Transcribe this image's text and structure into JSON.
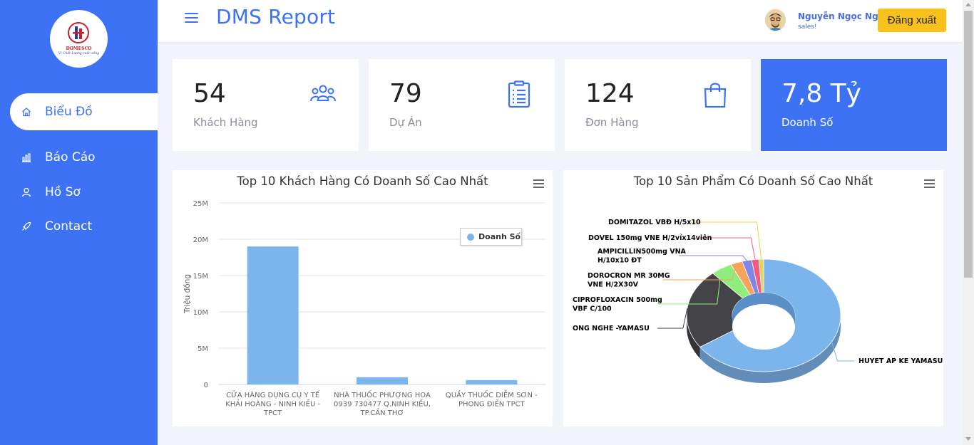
{
  "app": {
    "title": "DMS Report",
    "logo": {
      "brand": "DOMESCO",
      "slogan": "Vì Chất Lượng cuộc sống"
    }
  },
  "sidebar": {
    "items": [
      {
        "label": "Biểu Đồ",
        "icon": "home-icon",
        "active": true
      },
      {
        "label": "Báo Cáo",
        "icon": "bar-chart-icon",
        "active": false
      },
      {
        "label": "Hồ Sơ",
        "icon": "user-icon",
        "active": false
      },
      {
        "label": "Contact",
        "icon": "rocket-icon",
        "active": false
      }
    ]
  },
  "header": {
    "user_name": "Nguyễn Ngọc Ngân",
    "user_role": "sales!",
    "logout_label": "Đăng xuất"
  },
  "stats": [
    {
      "value": "54",
      "label": "Khách Hàng",
      "icon": "users-icon"
    },
    {
      "value": "79",
      "label": "Dự Án",
      "icon": "clipboard-icon"
    },
    {
      "value": "124",
      "label": "Đơn Hàng",
      "icon": "shopping-bag-icon"
    },
    {
      "value": "7,8 Tỷ",
      "label": "Doanh Số"
    }
  ],
  "colors": {
    "primary": "#3d72f5",
    "logout": "#f9c11b",
    "bar": "#7cb5ec"
  },
  "chart_data": [
    {
      "type": "bar",
      "title": "Top 10 Khách Hàng Có Doanh Số Cao Nhất",
      "ylabel": "Triệu đồng",
      "ylim": [
        0,
        25000000
      ],
      "y_ticks": [
        "0",
        "5M",
        "10M",
        "15M",
        "20M",
        "25M"
      ],
      "grid": true,
      "legend_position": "top-right",
      "categories": [
        [
          "CỬA HÀNG DỤNG CỤ Y TẾ",
          "KHẢI HOÀNG - NINH KIỀU -",
          "TPCT"
        ],
        [
          "NHÀ THUỐC PHƯỢNG HOA",
          "0939 730477 Q.NINH KIỀU,",
          "TP.CẦN THƠ"
        ],
        [
          "QUẦY THUỐC DIỄM SƠN -",
          "PHONG ĐIỀN TPCT"
        ]
      ],
      "series": [
        {
          "name": "Doanh Số",
          "values": [
            19000000,
            1000000,
            600000
          ]
        }
      ]
    },
    {
      "type": "pie",
      "title": "Top 10 Sản Phẩm Có Doanh Số Cao Nhất",
      "slices": [
        {
          "label": "HUYET AP KE YAMASU",
          "value": 65.5,
          "color": "#7cb5ec"
        },
        {
          "label": "ONG NGHE -YAMASU",
          "value": 23.0,
          "color": "#434348"
        },
        {
          "label": "CIPROFLOXACIN 500mg VBF C/100",
          "value": 4.5,
          "color": "#90ed7d"
        },
        {
          "label": "DOROCRON MR 30MG VNE H/2X30V",
          "value": 2.5,
          "color": "#f7a35c"
        },
        {
          "label": "AMPICILLIN500mg VNA H/10x10 ĐT",
          "value": 2.0,
          "color": "#8085e9"
        },
        {
          "label": "DOVEL 150mg VNE H/2vỉx14viên",
          "value": 1.5,
          "color": "#f15c80"
        },
        {
          "label": "DOMITAZOL VBĐ H/5x10",
          "value": 1.0,
          "color": "#e4d354"
        }
      ]
    }
  ]
}
